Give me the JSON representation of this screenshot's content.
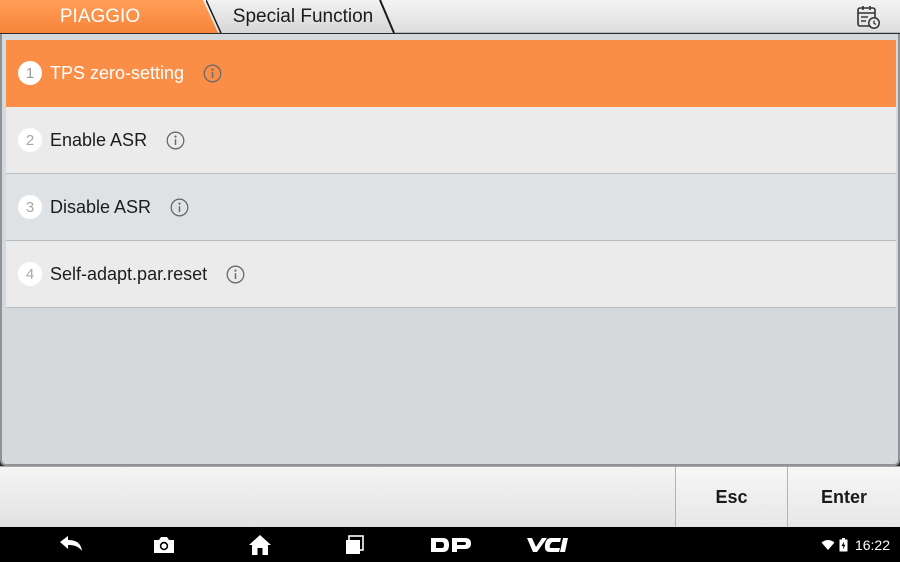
{
  "header": {
    "brand": "PIAGGIO",
    "function": "Special Function",
    "report_icon": "calendar-clock-icon"
  },
  "functions": [
    {
      "number": "1",
      "label": "TPS zero-setting",
      "selected": true
    },
    {
      "number": "2",
      "label": "Enable ASR",
      "selected": false
    },
    {
      "number": "3",
      "label": "Disable ASR",
      "selected": false
    },
    {
      "number": "4",
      "label": "Self-adapt.par.reset",
      "selected": false
    }
  ],
  "actions": {
    "esc": "Esc",
    "enter": "Enter"
  },
  "navbar": {
    "icons": [
      "back-icon",
      "camera-icon",
      "home-icon",
      "recent-apps-icon",
      "dp-logo-icon",
      "vci-icon"
    ],
    "time": "16:22"
  },
  "colors": {
    "accent": "#fb8e47",
    "panel": "#d6d9dc",
    "navbar": "#000000"
  }
}
